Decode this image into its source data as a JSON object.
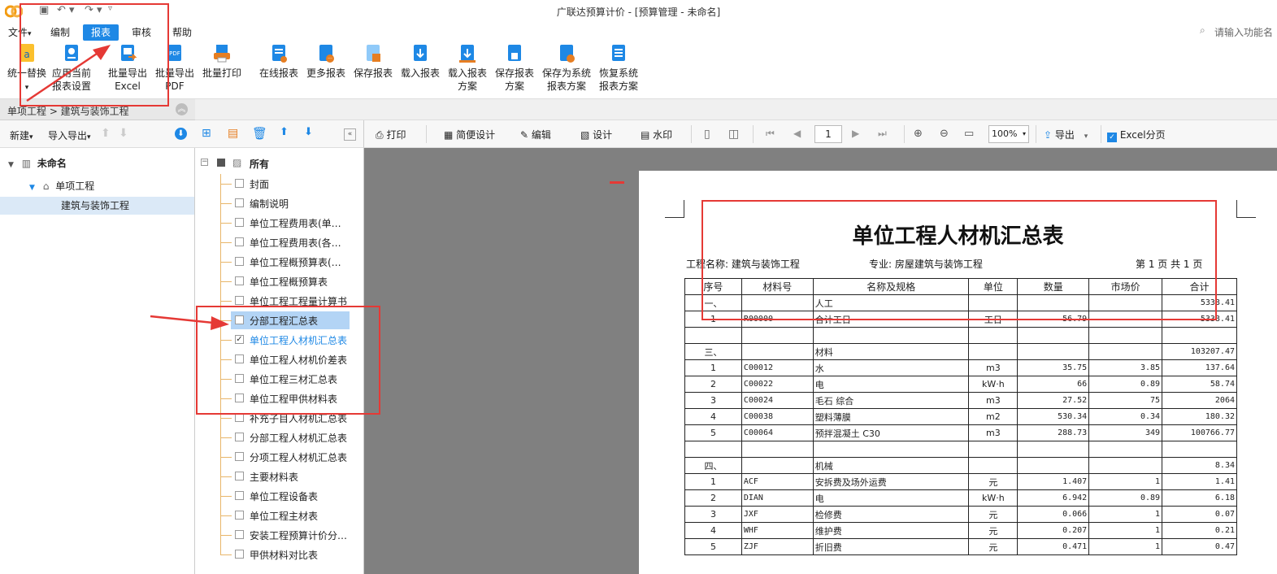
{
  "window": {
    "title": "广联达预算计价 - [预算管理 - 未命名]"
  },
  "menus": [
    {
      "label": "文件",
      "arrow": "▾"
    },
    {
      "label": "编制"
    },
    {
      "label": "报表",
      "active": true
    },
    {
      "label": "审核"
    },
    {
      "label": "帮助"
    }
  ],
  "search": {
    "placeholder": "请输入功能名"
  },
  "ribbon": [
    {
      "l1": "统一替换",
      "l2": "▾"
    },
    {
      "l1": "应用当前",
      "l2": "报表设置"
    },
    {
      "l1": "批量导出",
      "l2": "Excel"
    },
    {
      "l1": "批量导出",
      "l2": "PDF"
    },
    {
      "l1": "批量打印",
      "l2": ""
    },
    {
      "l1": "在线报表",
      "l2": ""
    },
    {
      "l1": "更多报表",
      "l2": ""
    },
    {
      "l1": "保存报表",
      "l2": ""
    },
    {
      "l1": "载入报表",
      "l2": ""
    },
    {
      "l1": "载入报表",
      "l2": "方案"
    },
    {
      "l1": "保存报表",
      "l2": "方案"
    },
    {
      "l1": "保存为系统",
      "l2": "报表方案"
    },
    {
      "l1": "恢复系统",
      "l2": "报表方案"
    }
  ],
  "breadcrumb": {
    "text": "单项工程 > 建筑与装饰工程"
  },
  "left_toolbar": {
    "new_label": "新建",
    "import_label": "导入导出"
  },
  "project_tree": {
    "root": "未命名",
    "child": "单项工程",
    "leaf": "建筑与装饰工程"
  },
  "report_tree": {
    "root": "所有",
    "items": [
      {
        "label": "封面",
        "checked": false
      },
      {
        "label": "编制说明",
        "checked": false
      },
      {
        "label": "单位工程费用表(单…",
        "checked": false
      },
      {
        "label": "单位工程费用表(各…",
        "checked": false
      },
      {
        "label": "单位工程概预算表(…",
        "checked": false
      },
      {
        "label": "单位工程概预算表",
        "checked": false
      },
      {
        "label": "单位工程工程量计算书",
        "checked": false
      },
      {
        "label": "分部工程汇总表",
        "checked": false,
        "hover": true
      },
      {
        "label": "单位工程人材机汇总表",
        "checked": true,
        "selected": true
      },
      {
        "label": "单位工程人材机价差表",
        "checked": false
      },
      {
        "label": "单位工程三材汇总表",
        "checked": false
      },
      {
        "label": "单位工程甲供材料表",
        "checked": false
      },
      {
        "label": "补充子目人材机汇总表",
        "checked": false
      },
      {
        "label": "分部工程人材机汇总表",
        "checked": false
      },
      {
        "label": "分项工程人材机汇总表",
        "checked": false
      },
      {
        "label": "主要材料表",
        "checked": false
      },
      {
        "label": "单位工程设备表",
        "checked": false
      },
      {
        "label": "单位工程主材表",
        "checked": false
      },
      {
        "label": "安装工程预算计价分…",
        "checked": false
      },
      {
        "label": "甲供材料对比表",
        "checked": false
      }
    ]
  },
  "viewer_toolbar": {
    "print": "打印",
    "simple_design": "简便设计",
    "edit": "编辑",
    "design": "设计",
    "watermark": "水印",
    "page": "1",
    "zoom": "100%",
    "export": "导出",
    "excel_paging": "Excel分页"
  },
  "report": {
    "title": "单位工程人材机汇总表",
    "project_label": "工程名称: 建筑与装饰工程",
    "major_label": "专业: 房屋建筑与装饰工程",
    "page_label": "第  1  页  共  1  页",
    "headers": [
      "序号",
      "材料号",
      "名称及规格",
      "单位",
      "数量",
      "市场价",
      "合计"
    ],
    "rows": [
      [
        "一、",
        "",
        "人工",
        "",
        "",
        "",
        "5338.41"
      ],
      [
        "1",
        "R00000",
        "合计工日",
        "工日",
        "56.79",
        "",
        "5338.41"
      ],
      [
        "",
        "",
        "",
        "",
        "",
        "",
        ""
      ],
      [
        "三、",
        "",
        "材料",
        "",
        "",
        "",
        "103207.47"
      ],
      [
        "1",
        "C00012",
        "水",
        "m3",
        "35.75",
        "3.85",
        "137.64"
      ],
      [
        "2",
        "C00022",
        "电",
        "kW·h",
        "66",
        "0.89",
        "58.74"
      ],
      [
        "3",
        "C00024",
        "毛石 综合",
        "m3",
        "27.52",
        "75",
        "2064"
      ],
      [
        "4",
        "C00038",
        "塑料薄膜",
        "m2",
        "530.34",
        "0.34",
        "180.32"
      ],
      [
        "5",
        "C00064",
        "预拌混凝土 C30",
        "m3",
        "288.73",
        "349",
        "100766.77"
      ],
      [
        "",
        "",
        "",
        "",
        "",
        "",
        ""
      ],
      [
        "四、",
        "",
        "机械",
        "",
        "",
        "",
        "8.34"
      ],
      [
        "1",
        "ACF",
        "安拆费及场外运费",
        "元",
        "1.407",
        "1",
        "1.41"
      ],
      [
        "2",
        "DIAN",
        "电",
        "kW·h",
        "6.942",
        "0.89",
        "6.18"
      ],
      [
        "3",
        "JXF",
        "检修费",
        "元",
        "0.066",
        "1",
        "0.07"
      ],
      [
        "4",
        "WHF",
        "维护费",
        "元",
        "0.207",
        "1",
        "0.21"
      ],
      [
        "5",
        "ZJF",
        "折旧费",
        "元",
        "0.471",
        "1",
        "0.47"
      ]
    ]
  },
  "colors": {
    "accent": "#1e88e5",
    "annotation": "#e53935",
    "selected_text": "#1e88e5",
    "hover_bg": "#b3d4f5"
  }
}
